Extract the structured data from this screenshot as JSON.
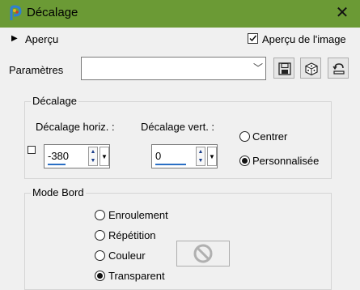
{
  "window": {
    "title": "Décalage",
    "close_glyph": "✕",
    "icon": "paint-icon"
  },
  "preview": {
    "label": "Aperçu",
    "checkbox_label": "Aperçu de l'image",
    "checked": true
  },
  "presets": {
    "label": "Paramètres",
    "value": ""
  },
  "offset_group": {
    "label": "Décalage",
    "horizontal": {
      "label": "Décalage horiz. :",
      "value": "-380"
    },
    "vertical": {
      "label": "Décalage vert. :",
      "value": "0"
    },
    "center_label": "Centrer",
    "custom_label": "Personnalisée",
    "selected": "Personnalisée"
  },
  "edge_group": {
    "label": "Mode Bord",
    "options": [
      "Enroulement",
      "Répétition",
      "Couleur",
      "Transparent"
    ],
    "selected": "Transparent"
  },
  "colors": {
    "titlebar": "#6b9a35",
    "accent": "#2a6fc4"
  }
}
